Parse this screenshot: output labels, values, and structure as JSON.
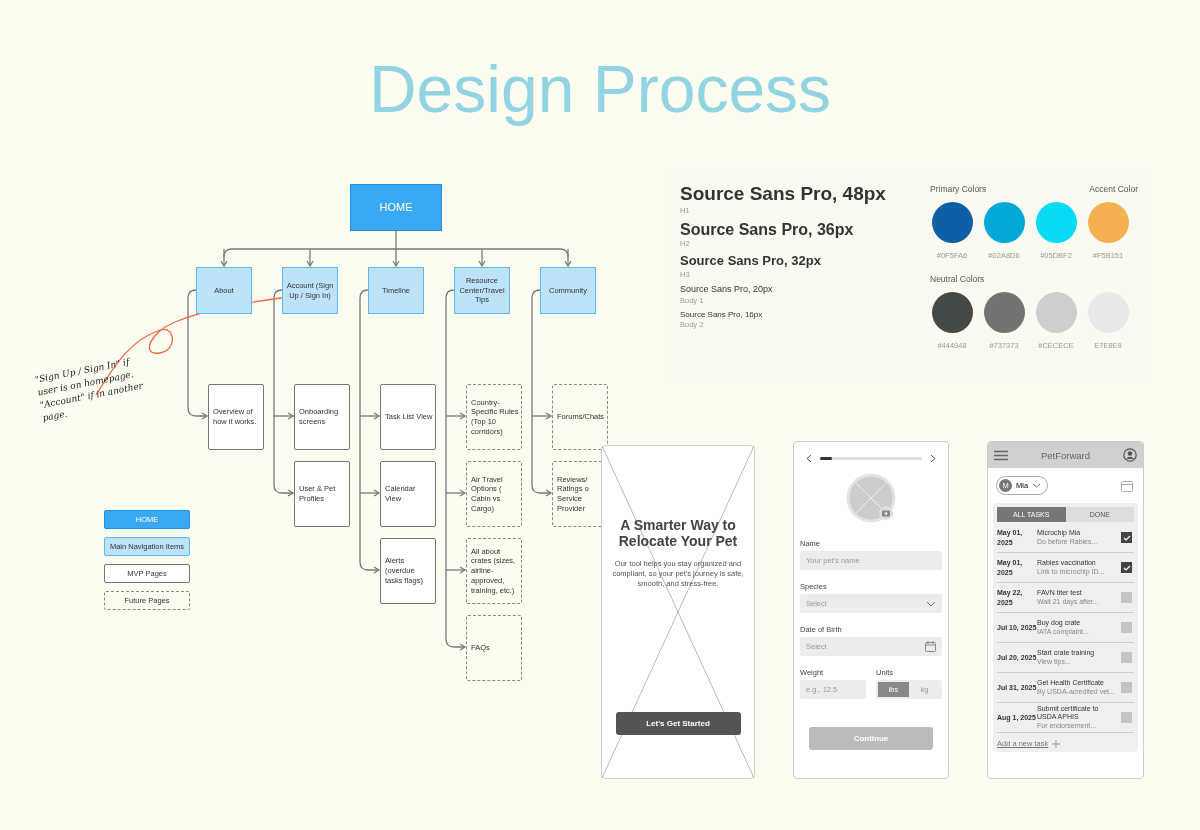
{
  "title": "Design Process",
  "sitemap": {
    "home": "HOME",
    "sections": [
      {
        "label": "About",
        "children": [
          {
            "label": "Overview of how it works.",
            "kind": "mvp"
          }
        ]
      },
      {
        "label": "Account (Sign Up / Sign In)",
        "children": [
          {
            "label": "Onboarding screens",
            "kind": "mvp"
          },
          {
            "label": "User & Pet Profiles",
            "kind": "mvp"
          }
        ]
      },
      {
        "label": "Timeline",
        "children": [
          {
            "label": "Task List View",
            "kind": "mvp"
          },
          {
            "label": "Calendar View",
            "kind": "mvp"
          },
          {
            "label": "Alerts (overdue tasks flags)",
            "kind": "mvp"
          }
        ]
      },
      {
        "label": "Resource Center/Travel Tips",
        "children": [
          {
            "label": "Country-Specific Rules (Top 10 corridors)",
            "kind": "future"
          },
          {
            "label": "Air Travel Options ( Cabin vs Cargo)",
            "kind": "future"
          },
          {
            "label": "All about crates (sizes, airline-approved, training, etc.)",
            "kind": "future"
          },
          {
            "label": "FAQs",
            "kind": "future"
          }
        ]
      },
      {
        "label": "Community",
        "children": [
          {
            "label": "Forums/Chats",
            "kind": "future"
          },
          {
            "label": "Reviews/ Ratings o Service Provider",
            "kind": "future"
          }
        ]
      }
    ]
  },
  "annotation": "\"Sign Up / Sign In\" if user is on homepage. \"Account\" if in another page.",
  "legend": [
    {
      "label": "HOME",
      "kind": "home"
    },
    {
      "label": "Main Navigation Items",
      "kind": "nav"
    },
    {
      "label": "MVP Pages",
      "kind": "mvp"
    },
    {
      "label": "Future Pages",
      "kind": "future"
    }
  ],
  "style_guide": {
    "type_scale": [
      {
        "sample": "Source Sans Pro, 48px",
        "role": "H1"
      },
      {
        "sample": "Source Sans Pro, 36px",
        "role": "H2"
      },
      {
        "sample": "Source Sans Pro, 32px",
        "role": "H3"
      },
      {
        "sample": "Source Sans Pro, 20px",
        "role": "Body 1"
      },
      {
        "sample": "Source Sans Pro, 16px",
        "role": "Body 2"
      }
    ],
    "primary_heading": "Primary Colors",
    "accent_heading": "Accent Color",
    "neutral_heading": "Neutral Colors",
    "primary": [
      {
        "color": "#0f5fa6",
        "code": "#0F5FA6"
      },
      {
        "color": "#02a8d6",
        "code": "#02A8D6"
      },
      {
        "color": "#05dbf2",
        "code": "#05DBF2"
      }
    ],
    "accent": [
      {
        "color": "#f5b151",
        "code": "#F5B151"
      }
    ],
    "neutral": [
      {
        "color": "#444948",
        "code": "#444948"
      },
      {
        "color": "#737373",
        "code": "#737373"
      },
      {
        "color": "#cecece",
        "code": "#CECECE"
      },
      {
        "color": "#e7e8e9",
        "code": "E7E8E9"
      }
    ]
  },
  "welcome_screen": {
    "heading": "A Smarter Way to Relocate Your Pet",
    "body": "Our tool helps you stay organized and compliant, so your pet's journey is safe, smooth, and stress-free.",
    "button": "Let's Get Started"
  },
  "pet_form": {
    "progress": {
      "level": 0.12
    },
    "name": {
      "label": "Name",
      "placeholder": "Your pet's name"
    },
    "species": {
      "label": "Species",
      "placeholder": "Select"
    },
    "birth": {
      "label": "Date of Birth",
      "placeholder": "Select"
    },
    "weight": {
      "label": "Weight",
      "placeholder": "e.g., 12.5"
    },
    "units": {
      "label": "Units",
      "options": [
        {
          "label": "lbs",
          "selected": true
        },
        {
          "label": "kg",
          "selected": false
        }
      ]
    },
    "continue": {
      "label": "Continue",
      "disabled": true
    }
  },
  "task_screen": {
    "app_title": "PetForward",
    "pet": {
      "initial": "M",
      "name": "Mia"
    },
    "tabs": [
      {
        "label": "ALL TASKS",
        "selected": true
      },
      {
        "label": "DONE",
        "selected": false
      }
    ],
    "tasks": [
      {
        "date": "May 01, 2025",
        "title": "Microchip Mia",
        "note": "Do before Rabies...",
        "checked": true
      },
      {
        "date": "May 01, 2025",
        "title": "Rabies vaccination",
        "note": "Link to microchip ID...",
        "checked": true
      },
      {
        "date": "May 22, 2025",
        "title": "FAVN titer test",
        "note": "Wait 21 days after...",
        "checked": false
      },
      {
        "date": "Jul 10, 2025",
        "title": "Buy dog crate",
        "note": "IATA complaint...",
        "checked": false
      },
      {
        "date": "Jul 20, 2025",
        "title": "Start crate training",
        "note": "View tips...",
        "checked": false
      },
      {
        "date": "Jul 31, 2025",
        "title": "Get Health Certificate",
        "note": "By USDA-acredited vet...",
        "checked": false
      },
      {
        "date": "Aug 1, 2025",
        "title": "Submit certificate to USDA APHIS",
        "note": "For endorsement...",
        "checked": false
      }
    ],
    "add_task": "Add a new task"
  }
}
